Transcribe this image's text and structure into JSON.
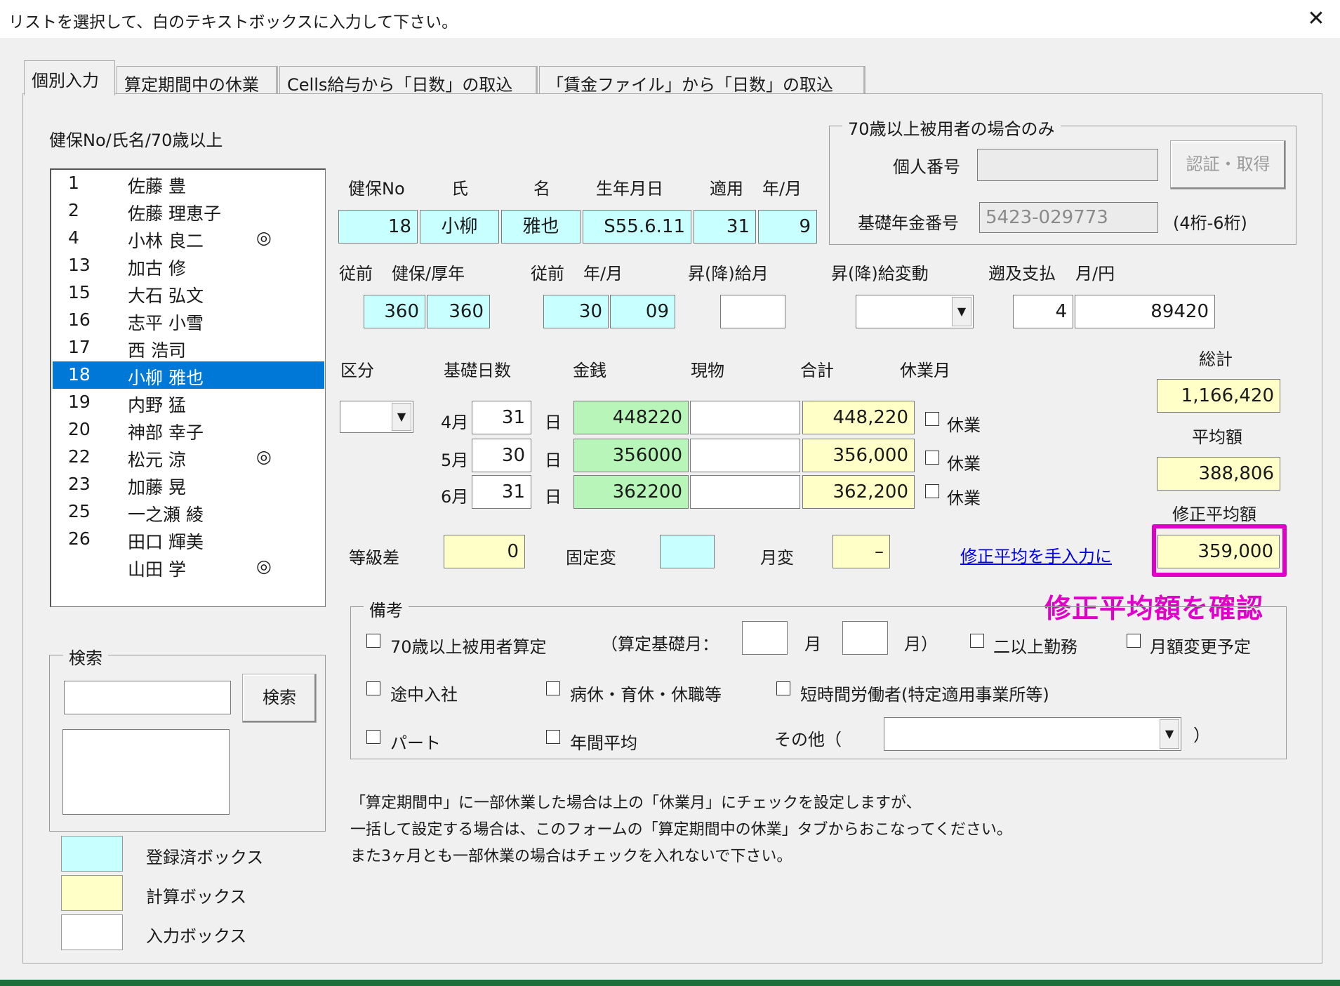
{
  "window": {
    "title": "リストを選択して、白のテキストボックスに入力して下さい。",
    "close": "✕"
  },
  "tabs": [
    {
      "label": "個別入力"
    },
    {
      "label": "算定期間中の休業"
    },
    {
      "label": "Cells給与から「日数」の取込"
    },
    {
      "label": "「賃金ファイル」から「日数」の取込"
    }
  ],
  "list": {
    "header": "健保No/氏名/70歳以上",
    "rows": [
      {
        "no": "1",
        "name": "佐藤 豊",
        "mark": ""
      },
      {
        "no": "2",
        "name": "佐藤 理恵子",
        "mark": ""
      },
      {
        "no": "4",
        "name": "小林 良二",
        "mark": "◎"
      },
      {
        "no": "13",
        "name": "加古 修",
        "mark": ""
      },
      {
        "no": "15",
        "name": "大石 弘文",
        "mark": ""
      },
      {
        "no": "16",
        "name": "志平 小雪",
        "mark": ""
      },
      {
        "no": "17",
        "name": "西 浩司",
        "mark": ""
      },
      {
        "no": "18",
        "name": "小柳 雅也",
        "mark": ""
      },
      {
        "no": "19",
        "name": "内野 猛",
        "mark": ""
      },
      {
        "no": "20",
        "name": "神部 幸子",
        "mark": ""
      },
      {
        "no": "22",
        "name": "松元 涼",
        "mark": "◎"
      },
      {
        "no": "23",
        "name": "加藤 晃",
        "mark": ""
      },
      {
        "no": "25",
        "name": "一之瀬 綾",
        "mark": ""
      },
      {
        "no": "26",
        "name": "田口 輝美",
        "mark": ""
      },
      {
        "no": "",
        "name": "山田 学",
        "mark": "◎"
      }
    ]
  },
  "over70": {
    "legend": "70歳以上被用者の場合のみ",
    "personal_no_label": "個人番号",
    "personal_no_value": "",
    "auth_button": "認証・取得",
    "pension_label": "基礎年金番号",
    "pension_value": "5423-029773",
    "pension_hint": "(4桁-6桁)"
  },
  "person": {
    "headers": {
      "no": "健保No",
      "sei": "氏",
      "mei": "名",
      "birth": "生年月日",
      "apply": "適用",
      "ym": "年/月"
    },
    "no": "18",
    "sei": "小柳",
    "mei": "雅也",
    "birth": "S55.6.11",
    "apply_year": "31",
    "apply_month": "9"
  },
  "prev": {
    "label_prev1": "従前",
    "label_kenpo": "健保/厚年",
    "kenpo": "360",
    "kosei": "360",
    "label_prev2": "従前",
    "label_ym": "年/月",
    "year": "30",
    "month": "09",
    "raise_month_label": "昇(降)給月",
    "raise_month_value": "",
    "raise_change_label": "昇(降)給変動",
    "raise_change_value": "",
    "retro_label": "遡及支払",
    "retro_unit_label": "月/円",
    "retro_month": "4",
    "retro_amount": "89420"
  },
  "salary": {
    "headers": {
      "kubun": "区分",
      "days": "基礎日数",
      "money": "金銭",
      "goods": "現物",
      "total": "合計",
      "leave": "休業月",
      "grand": "総計"
    },
    "kubun_value": "",
    "day_unit": "日",
    "leave_label": "休業",
    "rows": [
      {
        "month": "4月",
        "days": "31",
        "money": "448220",
        "goods": "",
        "total": "448,220"
      },
      {
        "month": "5月",
        "days": "30",
        "money": "356000",
        "goods": "",
        "total": "356,000"
      },
      {
        "month": "6月",
        "days": "31",
        "money": "362200",
        "goods": "",
        "total": "362,200"
      }
    ],
    "grand_total": "1,166,420",
    "average_label": "平均額",
    "average": "388,806",
    "corrected_label": "修正平均額",
    "corrected": "359,000"
  },
  "grade": {
    "diff_label": "等級差",
    "diff_value": "0",
    "fixed_label": "固定変",
    "fixed_value": "",
    "monthly_label": "月変",
    "monthly_value": "–",
    "manual_link": "修正平均を手入力に"
  },
  "annotation": "修正平均額を確認",
  "remarks": {
    "legend": "備考",
    "over70_calc": "70歳以上被用者算定",
    "base_month_open": "（算定基礎月：",
    "month_unit": "月",
    "month_close": "月）",
    "multi_work": "二以上勤務",
    "change_planned": "月額変更予定",
    "mid_join": "途中入社",
    "leave_types": "病休・育休・休職等",
    "short_time": "短時間労働者(特定適用事業所等)",
    "part": "パート",
    "annual_avg": "年間平均",
    "other_open": "その他（",
    "other_close": "）"
  },
  "search": {
    "legend": "検索",
    "input_value": "",
    "button": "検索"
  },
  "legend_boxes": {
    "registered": "登録済ボックス",
    "calc": "計算ボックス",
    "input": "入力ボックス"
  },
  "notes": [
    "「算定期間中」に一部休業した場合は上の「休業月」にチェックを設定しますが、",
    "一括して設定する場合は、このフォームの「算定期間中の休業」タブからおこなってください。",
    "また3ヶ月とも一部休業の場合はチェックを入れないで下さい。"
  ],
  "colors": {
    "registered": "#c8ffff",
    "calc": "#ffffc8",
    "money": "#b8f5b8",
    "selection": "#0078d7",
    "highlight": "#e000c8"
  }
}
